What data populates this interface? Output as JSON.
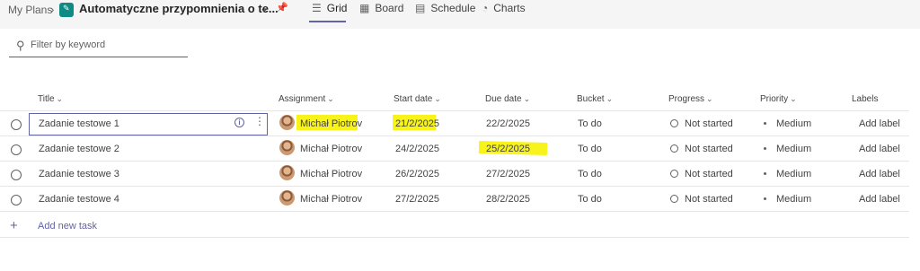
{
  "header": {
    "breadcrumb": "My Plans",
    "plan_title": "Automatyczne przypomnienia o te...",
    "tabs": [
      {
        "label": "Grid",
        "icon": "grid-icon",
        "active": true
      },
      {
        "label": "Board",
        "icon": "board-icon",
        "active": false
      },
      {
        "label": "Schedule",
        "icon": "calendar-icon",
        "active": false
      },
      {
        "label": "Charts",
        "icon": "chart-icon",
        "active": false
      }
    ]
  },
  "filter": {
    "placeholder": "Filter by keyword",
    "value": ""
  },
  "columns": [
    "Title",
    "Assignment",
    "Start date",
    "Due date",
    "Bucket",
    "Progress",
    "Priority",
    "Labels"
  ],
  "tasks": [
    {
      "title": "Zadanie testowe 1",
      "assignee": "Michał Piotrov",
      "start": "21/2/2025",
      "due": "22/2/2025",
      "bucket": "To do",
      "progress": "Not started",
      "priority": "Medium",
      "labels": "Add label"
    },
    {
      "title": "Zadanie testowe 2",
      "assignee": "Michał Piotrov",
      "start": "24/2/2025",
      "due": "25/2/2025",
      "bucket": "To do",
      "progress": "Not started",
      "priority": "Medium",
      "labels": "Add label"
    },
    {
      "title": "Zadanie testowe 3",
      "assignee": "Michał Piotrov",
      "start": "26/2/2025",
      "due": "27/2/2025",
      "bucket": "To do",
      "progress": "Not started",
      "priority": "Medium",
      "labels": "Add label"
    },
    {
      "title": "Zadanie testowe 4",
      "assignee": "Michał Piotrov",
      "start": "27/2/2025",
      "due": "28/2/2025",
      "bucket": "To do",
      "progress": "Not started",
      "priority": "Medium",
      "labels": "Add label"
    }
  ],
  "add_task_label": "Add new task",
  "colors": {
    "accent": "#6264a7",
    "highlight": "#f7f31b",
    "plan_icon": "#0f8a84"
  }
}
